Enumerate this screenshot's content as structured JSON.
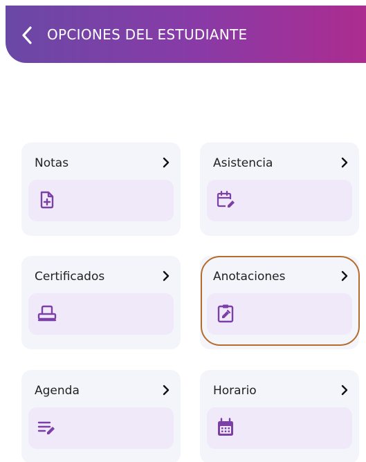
{
  "header": {
    "title": "OPCIONES DEL ESTUDIANTE"
  },
  "colors": {
    "header_gradient_start": "#6a48a6",
    "header_gradient_end": "#ac2c8f",
    "icon_purple": "#7b3fa6",
    "card_background": "#f4f4fb",
    "icon_box_background": "#efe9f9",
    "highlight_border": "#b36c2b"
  },
  "cards": [
    {
      "label": "Notas",
      "icon": "document-plus-icon"
    },
    {
      "label": "Asistencia",
      "icon": "calendar-edit-icon"
    },
    {
      "label": "Certificados",
      "icon": "printer-icon"
    },
    {
      "label": "Anotaciones",
      "icon": "clipboard-edit-icon"
    },
    {
      "label": "Agenda",
      "icon": "list-edit-icon"
    },
    {
      "label": "Horario",
      "icon": "calendar-grid-icon"
    }
  ]
}
